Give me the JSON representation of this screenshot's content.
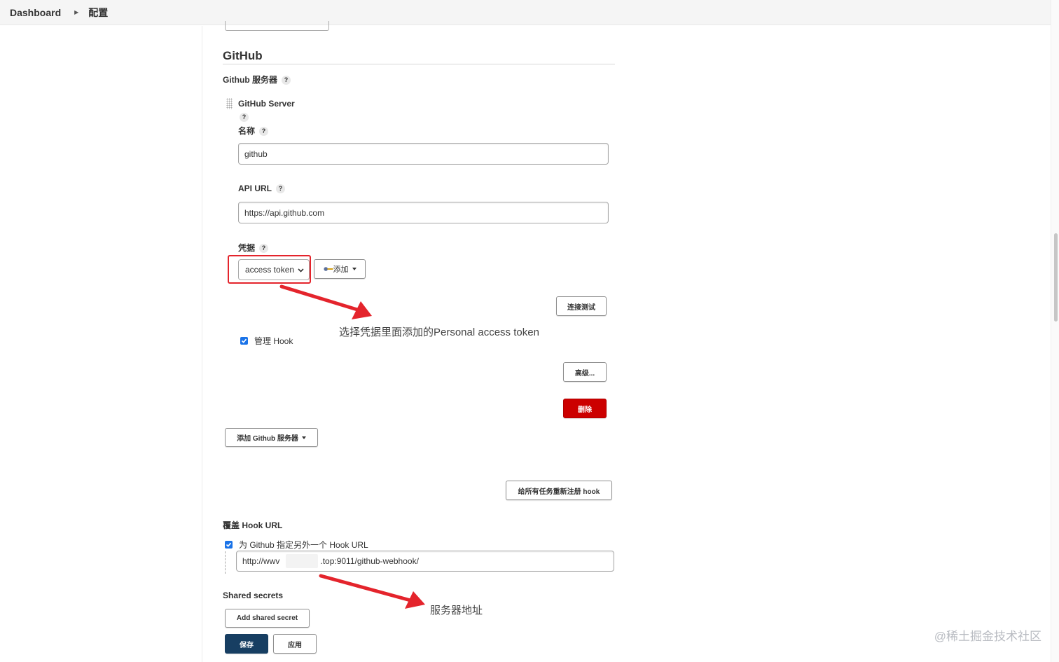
{
  "breadcrumb": {
    "home": "Dashboard",
    "current": "配置"
  },
  "github_section": {
    "title": "GitHub",
    "servers_label": "Github 服务器",
    "server_block_title": "GitHub Server",
    "name_label": "名称",
    "name_value": "github",
    "api_url_label": "API URL",
    "api_url_value": "https://api.github.com",
    "credentials_label": "凭据",
    "credentials_selected": "access token",
    "add_button": "添加",
    "test_connection_button": "连接测试",
    "manage_hook_label": "管理 Hook",
    "manage_hook_checked": true,
    "advanced_button": "高级...",
    "delete_button": "删除",
    "add_server_button": "添加 Github 服务器",
    "reregister_hooks_button": "给所有任务重新注册 hook",
    "override_hook_title": "覆盖 Hook URL",
    "override_hook_checkbox_label": "为 Github 指定另外一个 Hook URL",
    "override_hook_checked": true,
    "hook_url_prefix": "http://wwv",
    "hook_url_suffix": ".top:9011/github-webhook/",
    "shared_secrets_title": "Shared secrets",
    "add_shared_secret_button": "Add shared secret"
  },
  "footer_buttons": {
    "save": "保存",
    "apply": "应用"
  },
  "annotations": {
    "credential_note": "选择凭据里面添加的Personal access token",
    "server_note": "服务器地址"
  },
  "watermark": "@稀土掘金技术社区",
  "colors": {
    "annotation_red": "#e4242c",
    "danger": "#cc0000",
    "primary": "#173e62",
    "checkbox": "#1a73e8"
  }
}
